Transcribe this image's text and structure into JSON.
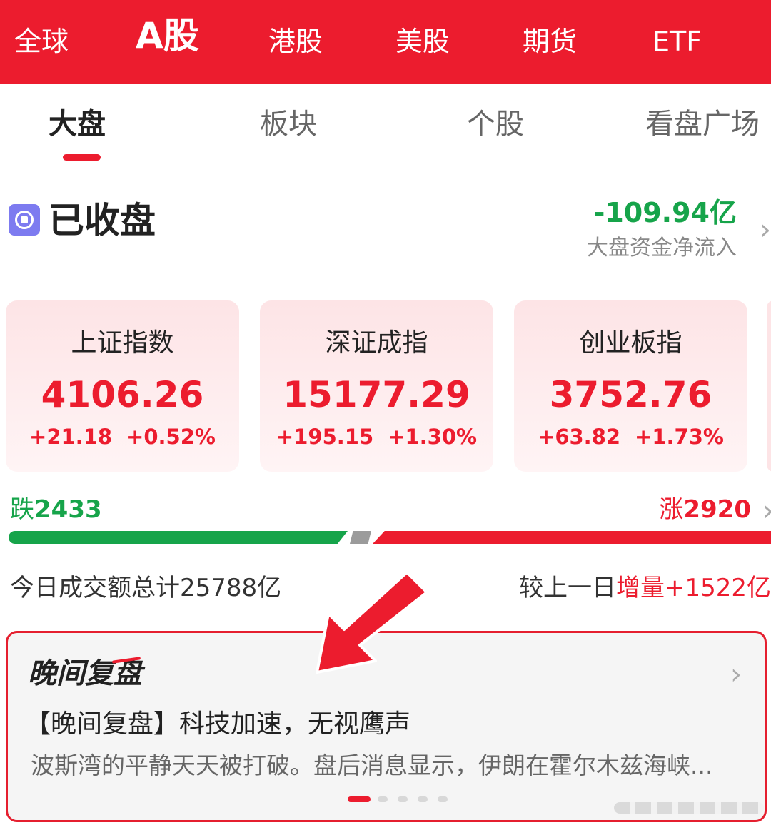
{
  "market_tabs": [
    "全球",
    "A股",
    "港股",
    "美股",
    "期货",
    "ETF"
  ],
  "sub_tabs": [
    "大盘",
    "板块",
    "个股",
    "看盘广场"
  ],
  "status": "已收盘",
  "fund_flow": {
    "value": "-109.94亿",
    "label": "大盘资金净流入"
  },
  "indices": [
    {
      "name": "上证指数",
      "value": "4106.26",
      "change": "+21.18",
      "pct": "+0.52%"
    },
    {
      "name": "深证成指",
      "value": "15177.29",
      "change": "+195.15",
      "pct": "+1.30%"
    },
    {
      "name": "创业板指",
      "value": "3752.76",
      "change": "+63.82",
      "pct": "+1.73%"
    }
  ],
  "breadth": {
    "fall_label": "跌",
    "fall": "2433",
    "rise_label": "涨",
    "rise": "2920"
  },
  "turnover": "今日成交额总计25788亿",
  "compare": {
    "prefix": "较上一日",
    "label": "增量",
    "value": "+1522亿"
  },
  "review": {
    "title": "晚间复盘",
    "headline": "【晚间复盘】科技加速，无视鹰声",
    "body": "波斯湾的平静天天被打破。盘后消息显示，伊朗在霍尔木兹海峡..."
  },
  "colors": {
    "accent": "#ec1c2e",
    "up": "#ec1c2e",
    "down": "#16a44a"
  },
  "icons": {
    "status": "stop-icon",
    "chevron": "chevron-right-icon",
    "annotation": "red-arrow-icon"
  }
}
